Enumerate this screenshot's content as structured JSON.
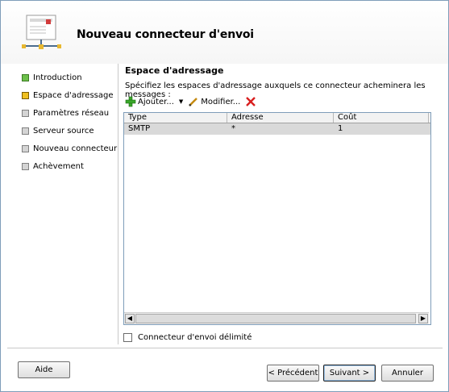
{
  "header": {
    "title": "Nouveau connecteur d'envoi",
    "icon": "mail-network-icon"
  },
  "nav": [
    {
      "label": "Introduction",
      "state": "green"
    },
    {
      "label": "Espace d'adressage",
      "state": "yellow"
    },
    {
      "label": "Paramètres réseau",
      "state": "gray"
    },
    {
      "label": "Serveur source",
      "state": "gray"
    },
    {
      "label": "Nouveau connecteur",
      "state": "gray"
    },
    {
      "label": "Achèvement",
      "state": "gray"
    }
  ],
  "main": {
    "section_title": "Espace d'adressage",
    "description": "Spécifiez les espaces d'adressage auxquels ce connecteur acheminera les messages :",
    "toolbar": {
      "add_label": "Ajouter...",
      "edit_label": "Modifier..."
    },
    "table": {
      "columns": [
        "Type",
        "Adresse",
        "Coût"
      ],
      "rows": [
        {
          "type": "SMTP",
          "address": "*",
          "cost": "1"
        }
      ]
    },
    "checkbox_label": "Connecteur d'envoi délimité"
  },
  "footer": {
    "help": "Aide",
    "previous": "< Précédent",
    "next": "Suivant >",
    "cancel": "Annuler"
  },
  "colors": {
    "step_done": "#6cc04a",
    "step_current": "#f0c020",
    "step_pending": "#d4d4d4",
    "delete": "#d81e1e"
  }
}
